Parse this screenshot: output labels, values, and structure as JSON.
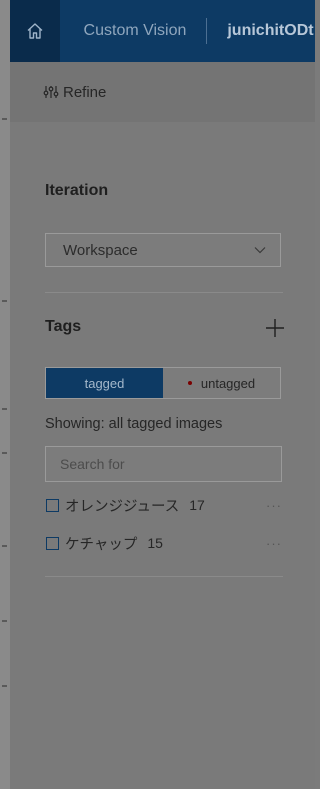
{
  "header": {
    "app_title": "Custom Vision",
    "project_name": "junichitODt",
    "home_icon": "home-icon"
  },
  "refine": {
    "label": "Refine",
    "icon": "filter-sliders-icon"
  },
  "iteration": {
    "title": "Iteration",
    "selected": "Workspace"
  },
  "tags": {
    "title": "Tags",
    "toggle": {
      "tagged_label": "tagged",
      "untagged_label": "untagged"
    },
    "showing_text": "Showing: all tagged images",
    "search_placeholder": "Search for",
    "items": [
      {
        "name": "オレンジジュース",
        "count": "17",
        "more": "···"
      },
      {
        "name": "ケチャップ",
        "count": "15",
        "more": "···"
      }
    ]
  },
  "colors": {
    "nav_bg": "#0d3a64",
    "home_bg": "#0a2b4b",
    "panel_bg": "#7a7a7a",
    "untagged_dot": "#7a0000"
  }
}
